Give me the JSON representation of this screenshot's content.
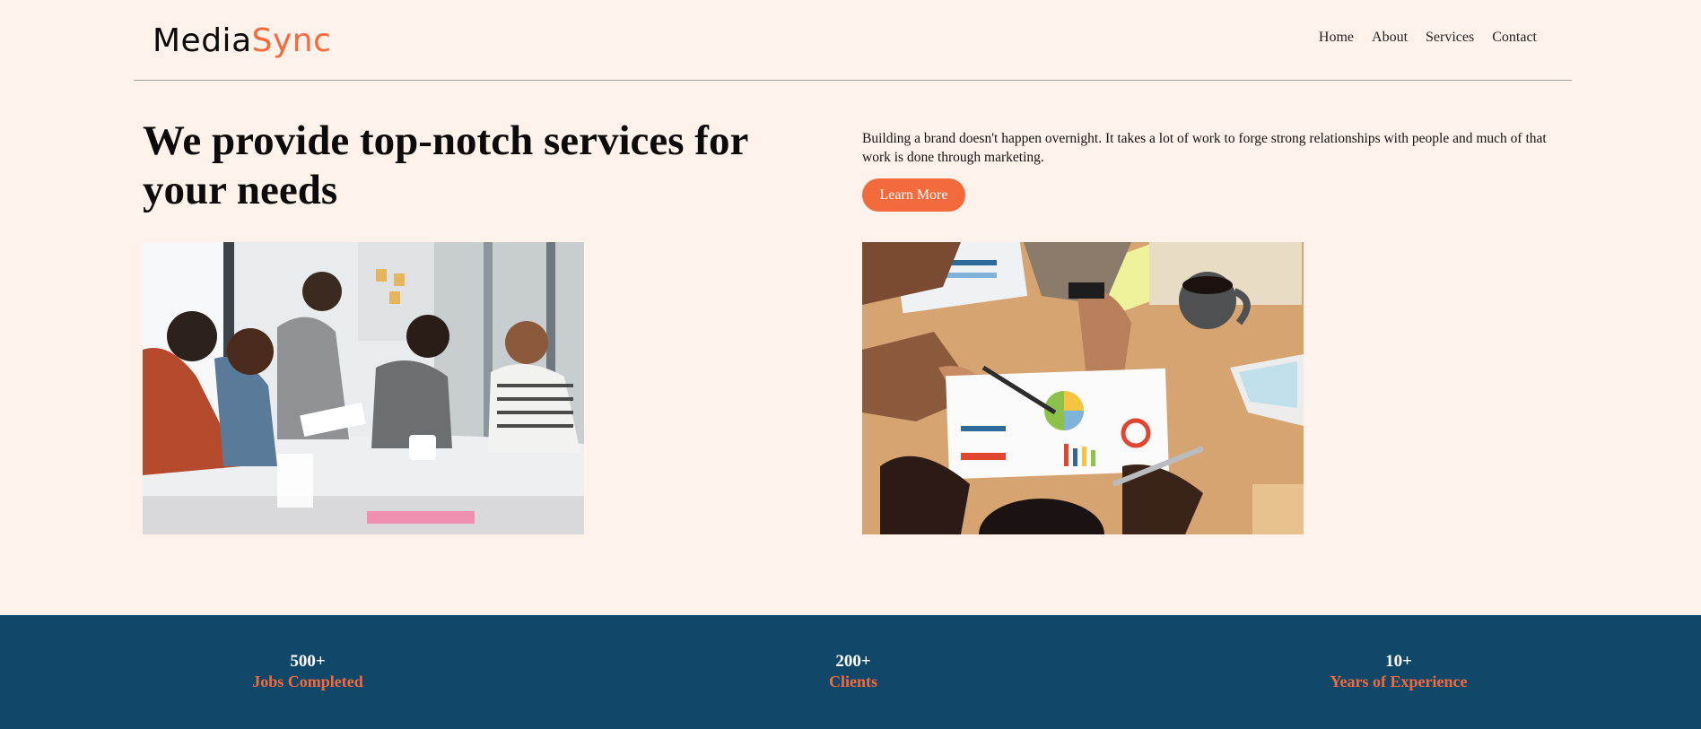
{
  "brand": {
    "part1": "Media",
    "part2": "Sync",
    "color_primary": "#0b0b0b",
    "color_accent": "#f36a3d"
  },
  "nav": {
    "items": [
      "Home",
      "About",
      "Services",
      "Contact"
    ]
  },
  "hero": {
    "title": "We provide top-notch services for your needs",
    "description": "Building a brand doesn't happen overnight. It takes a lot of work to forge strong relationships with people and much of that work is done through marketing.",
    "cta_label": "Learn More"
  },
  "images": [
    {
      "name": "team-meeting-photo"
    },
    {
      "name": "charts-desk-photo"
    }
  ],
  "stats": [
    {
      "value": "500+",
      "label": "Jobs Completed"
    },
    {
      "value": "200+",
      "label": "Clients"
    },
    {
      "value": "10+",
      "label": "Years of Experience"
    }
  ],
  "colors": {
    "background": "#fff2ea",
    "accent": "#f36a3d",
    "stats_band": "#114869"
  }
}
